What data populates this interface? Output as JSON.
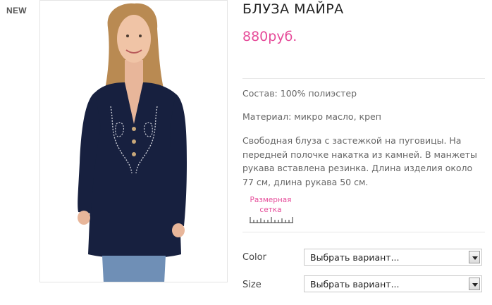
{
  "badge": {
    "label": "NEW"
  },
  "product": {
    "image_icon": "product-photo-blouse",
    "title": "БЛУЗА МАЙРА",
    "price": "880руб.",
    "composition": "Состав: 100% полиэстер",
    "material": "Материал: микро масло, креп",
    "description": "Свободная блуза с застежкой на пуговицы. На передней полочке накатка из камней. В манжеты рукава вставлена резинка. Длина изделия около 77 см, длина рукава 50 см."
  },
  "size_chart": {
    "label_line1": "Размерная",
    "label_line2": "сетка",
    "icon": "ruler-icon"
  },
  "options": {
    "color": {
      "label": "Color",
      "value": "Выбрать вариант..."
    },
    "size": {
      "label": "Size",
      "value": "Выбрать вариант..."
    }
  },
  "colors": {
    "accent": "#e64c9a",
    "text": "#666666"
  }
}
